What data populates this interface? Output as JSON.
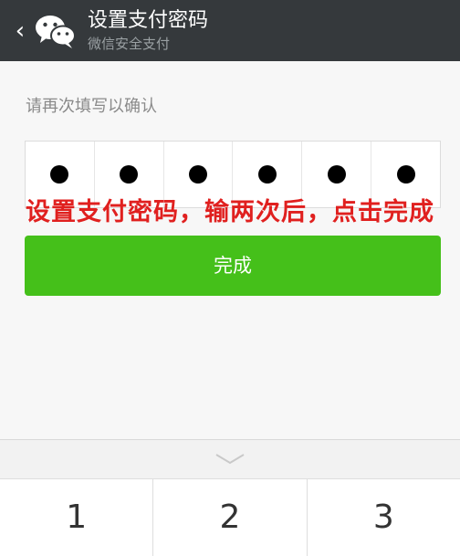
{
  "header": {
    "back_glyph": "‹",
    "title": "设置支付密码",
    "subtitle": "微信安全支付",
    "logo_icon": "wechat-logo-icon"
  },
  "form": {
    "prompt": "请再次填写以确认",
    "pin_length": 6,
    "filled_digits": 6
  },
  "annotation": "设置支付密码，输两次后，点击完成",
  "done_label": "完成",
  "keyboard": {
    "hide_icon": "chevron-down-icon",
    "keys": [
      "1",
      "2",
      "3"
    ]
  },
  "colors": {
    "header_bg": "#35393c",
    "primary_green": "#45c01a",
    "annotation_red": "#e0201f"
  }
}
